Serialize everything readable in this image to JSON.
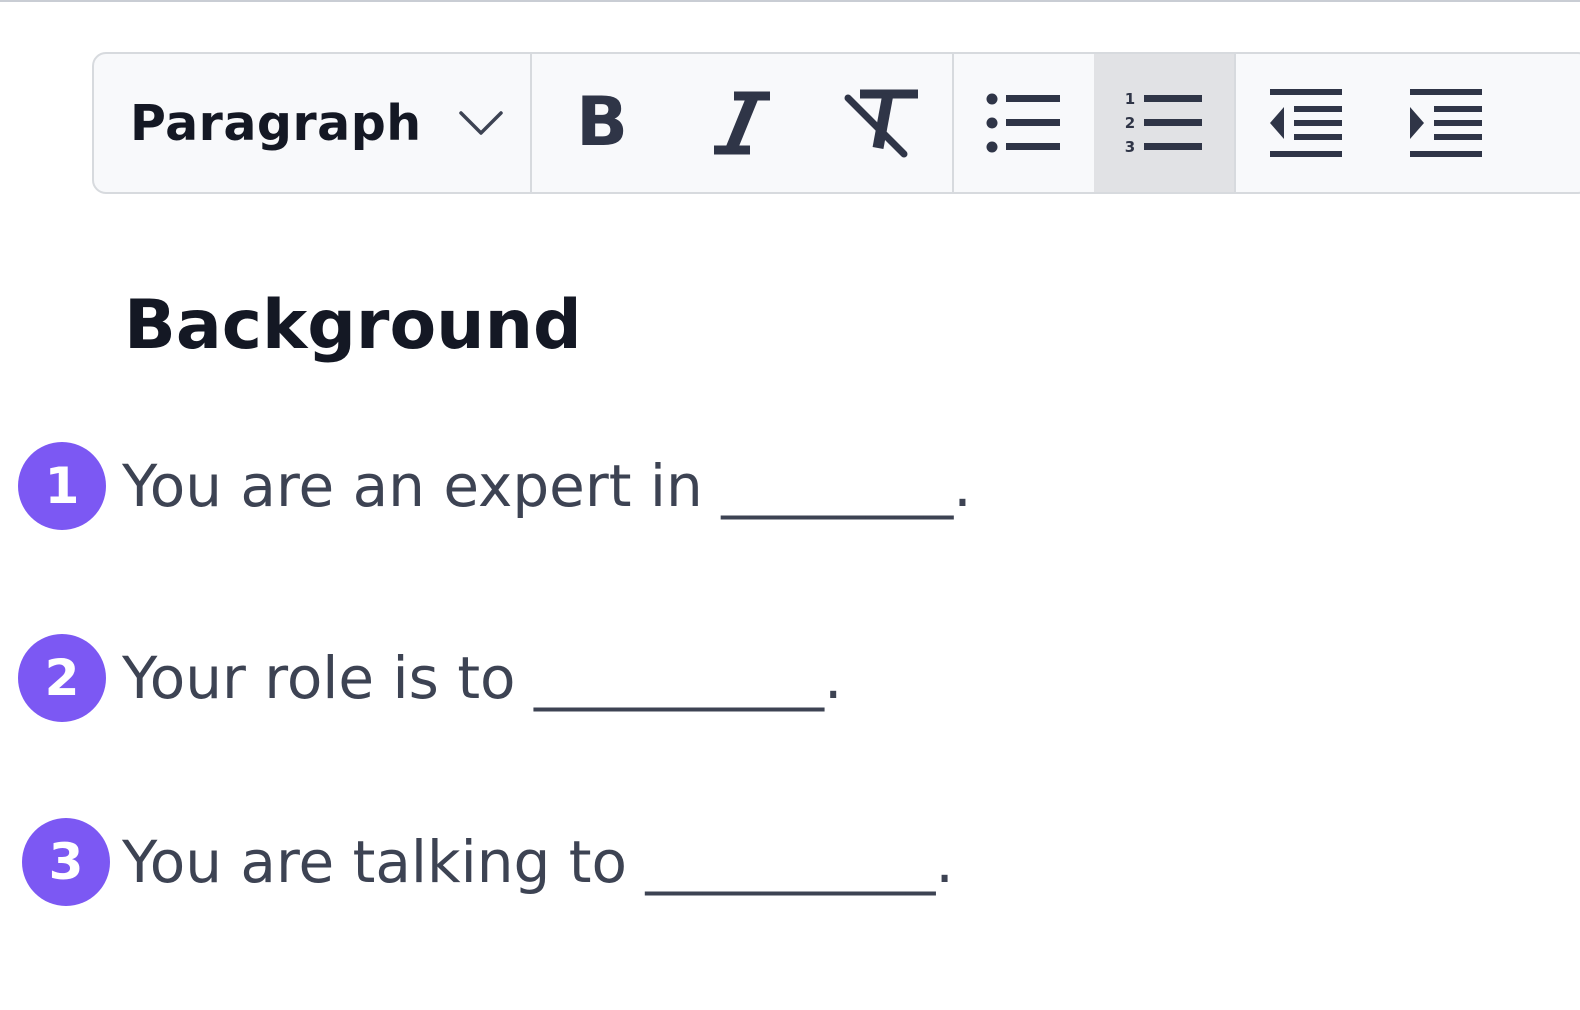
{
  "toolbar": {
    "block_style": "Paragraph",
    "block_style_icon": "chevron-down-icon",
    "buttons": [
      {
        "name": "bold",
        "icon": "bold-icon",
        "active": false
      },
      {
        "name": "italic",
        "icon": "italic-icon",
        "active": false
      },
      {
        "name": "clear-formatting",
        "icon": "clear-formatting-icon",
        "active": false
      },
      {
        "name": "bulleted-list",
        "icon": "bulleted-list-icon",
        "active": false
      },
      {
        "name": "numbered-list",
        "icon": "numbered-list-icon",
        "active": true
      },
      {
        "name": "outdent",
        "icon": "outdent-icon",
        "active": false
      },
      {
        "name": "indent",
        "icon": "indent-icon",
        "active": false
      }
    ]
  },
  "editor": {
    "heading": "Background",
    "items": [
      {
        "number": "1",
        "text": "You are an expert in ________."
      },
      {
        "number": "2",
        "text": "Your role is to __________."
      },
      {
        "number": "3",
        "text": "You are talking to __________."
      }
    ]
  },
  "colors": {
    "badge": "#7c58f3",
    "heading": "#141824",
    "body_text": "#3d4353",
    "toolbar_bg": "#f8f9fb",
    "active_button_bg": "#e1e2e5"
  }
}
